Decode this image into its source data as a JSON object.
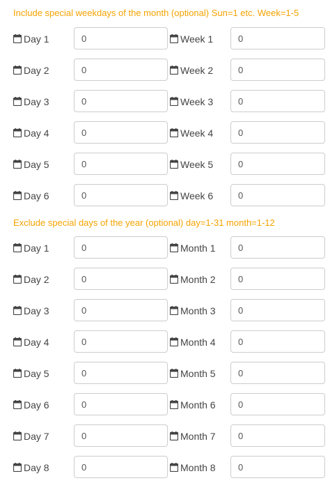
{
  "include_section": {
    "header": "Include special weekdays of the month (optional) Sun=1 etc. Week=1-5",
    "rows": [
      {
        "left_label": "Day 1",
        "left_value": "0",
        "right_label": "Week 1",
        "right_value": "0"
      },
      {
        "left_label": "Day 2",
        "left_value": "0",
        "right_label": "Week 2",
        "right_value": "0"
      },
      {
        "left_label": "Day 3",
        "left_value": "0",
        "right_label": "Week 3",
        "right_value": "0"
      },
      {
        "left_label": "Day 4",
        "left_value": "0",
        "right_label": "Week 4",
        "right_value": "0"
      },
      {
        "left_label": "Day 5",
        "left_value": "0",
        "right_label": "Week 5",
        "right_value": "0"
      },
      {
        "left_label": "Day 6",
        "left_value": "0",
        "right_label": "Week 6",
        "right_value": "0"
      }
    ]
  },
  "exclude_section": {
    "header": "Exclude special days of the year (optional) day=1-31 month=1-12",
    "rows": [
      {
        "left_label": "Day 1",
        "left_value": "0",
        "right_label": "Month 1",
        "right_value": "0"
      },
      {
        "left_label": "Day 2",
        "left_value": "0",
        "right_label": "Month 2",
        "right_value": "0"
      },
      {
        "left_label": "Day 3",
        "left_value": "0",
        "right_label": "Month 3",
        "right_value": "0"
      },
      {
        "left_label": "Day 4",
        "left_value": "0",
        "right_label": "Month 4",
        "right_value": "0"
      },
      {
        "left_label": "Day 5",
        "left_value": "0",
        "right_label": "Month 5",
        "right_value": "0"
      },
      {
        "left_label": "Day 6",
        "left_value": "0",
        "right_label": "Month 6",
        "right_value": "0"
      },
      {
        "left_label": "Day 7",
        "left_value": "0",
        "right_label": "Month 7",
        "right_value": "0"
      },
      {
        "left_label": "Day 8",
        "left_value": "0",
        "right_label": "Month 8",
        "right_value": "0"
      }
    ]
  },
  "icons": {
    "label_icon": "calendar-icon"
  },
  "colors": {
    "header_text": "#f5a300",
    "input_border": "#cccccc",
    "label_text": "#444444"
  }
}
